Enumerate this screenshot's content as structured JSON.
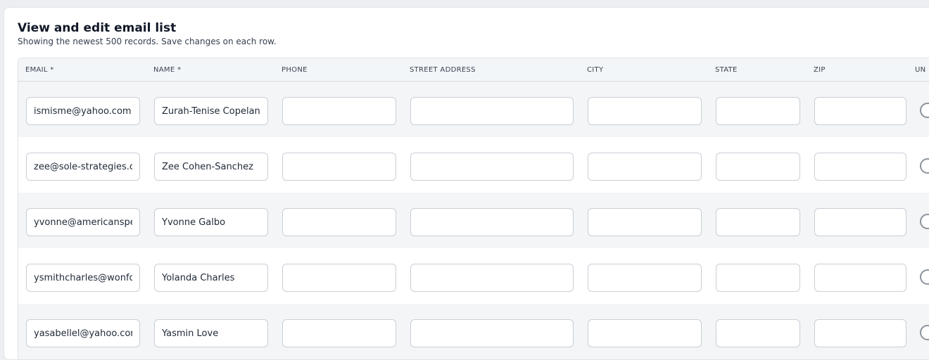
{
  "header": {
    "title": "View and edit email list",
    "subtitle": "Showing the newest 500 records. Save changes on each row."
  },
  "table": {
    "columns": {
      "email": "EMAIL *",
      "name": "NAME *",
      "phone": "PHONE",
      "street": "STREET ADDRESS",
      "city": "CITY",
      "state": "STATE",
      "zip": "ZIP",
      "unsubscribed": "UN"
    },
    "rows": [
      {
        "email": "ismisme@yahoo.com",
        "name": "Zurah-Tenise Copeland",
        "phone": "",
        "street": "",
        "city": "",
        "state": "",
        "zip": "",
        "unsubscribed": false
      },
      {
        "email": "zee@sole-strategies.com",
        "name": "Zee Cohen-Sanchez",
        "phone": "",
        "street": "",
        "city": "",
        "state": "",
        "zip": "",
        "unsubscribed": false
      },
      {
        "email": "yvonne@americanspec",
        "name": "Yvonne Galbo",
        "phone": "",
        "street": "",
        "city": "",
        "state": "",
        "zip": "",
        "unsubscribed": false
      },
      {
        "email": "ysmithcharles@wonfou",
        "name": "Yolanda Charles",
        "phone": "",
        "street": "",
        "city": "",
        "state": "",
        "zip": "",
        "unsubscribed": false
      },
      {
        "email": "yasabellel@yahoo.com",
        "name": "Yasmin Love",
        "phone": "",
        "street": "",
        "city": "",
        "state": "",
        "zip": "",
        "unsubscribed": false
      }
    ]
  },
  "colors": {
    "shaded_row": "#f3f5f6",
    "header_bg": "#f3f6f8",
    "input_border": "#c9cfd6"
  }
}
